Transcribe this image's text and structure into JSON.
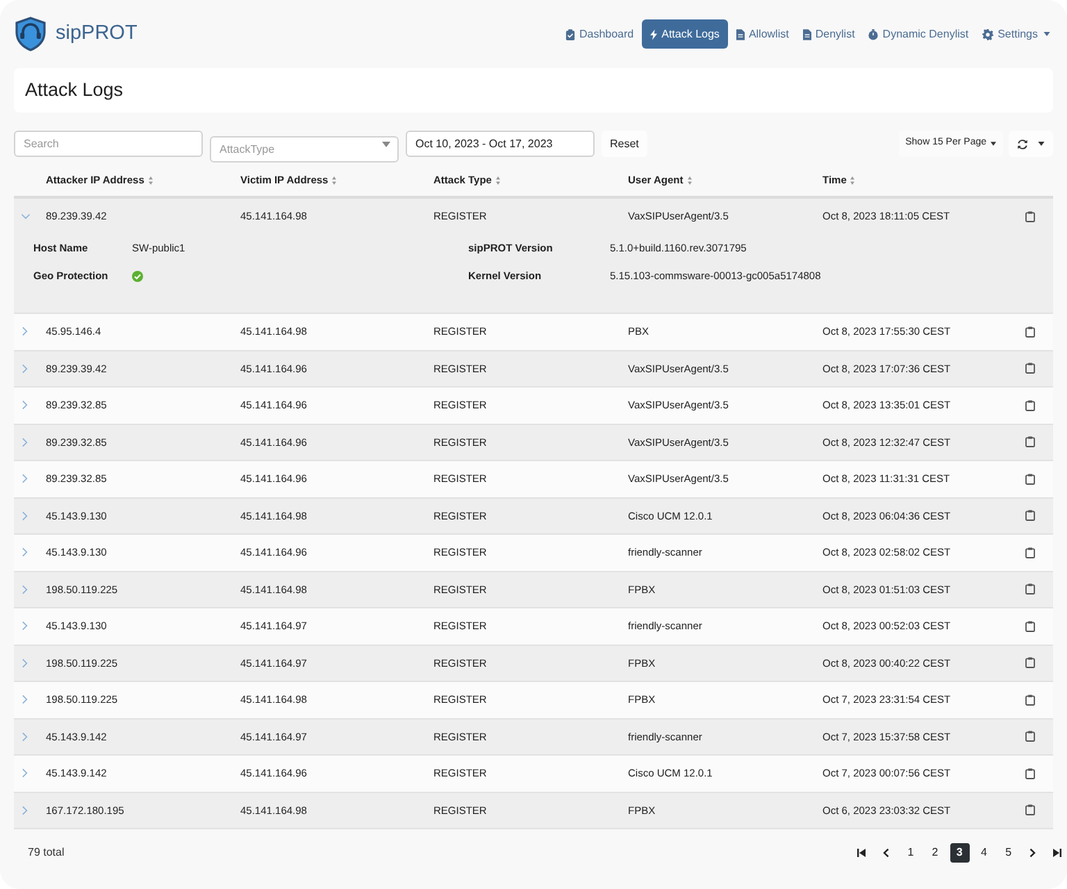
{
  "app": {
    "name": "sipPROT"
  },
  "nav": [
    {
      "label": "Dashboard",
      "selected": false,
      "dropdown": false
    },
    {
      "label": "Attack Logs",
      "selected": true,
      "dropdown": false
    },
    {
      "label": "Allowlist",
      "selected": false,
      "dropdown": false
    },
    {
      "label": "Denylist",
      "selected": false,
      "dropdown": false
    },
    {
      "label": "Dynamic Denylist",
      "selected": false,
      "dropdown": false
    },
    {
      "label": "Settings",
      "selected": false,
      "dropdown": true
    }
  ],
  "page": {
    "title": "Attack Logs"
  },
  "filters": {
    "search": {
      "placeholder": "Search"
    },
    "attack_type": {
      "placeholder": "AttackType"
    },
    "date_range": {
      "value": "Oct 10, 2023 - Oct 17, 2023"
    },
    "reset_button": "Reset",
    "per_page": "Show 15 Per Page"
  },
  "table": {
    "columns": [
      "Attacker IP Address",
      "Victim IP Address",
      "Attack Type",
      "User Agent",
      "Time"
    ],
    "rows": [
      {
        "expanded": true,
        "cells": [
          "89.239.39.42",
          "45.141.164.98",
          "REGISTER",
          "VaxSIPUserAgent/3.5",
          "Oct 8, 2023 18:11:05 CEST"
        ],
        "details": [
          {
            "kind": "text",
            "label": "Host Name",
            "value": "SW-public1"
          },
          {
            "kind": "text",
            "label": "sipPROT Version",
            "value": "5.1.0+build.1160.rev.3071795"
          },
          {
            "kind": "status",
            "label": "Geo Protection",
            "on": true
          },
          {
            "kind": "text",
            "label": "Kernel Version",
            "value": "5.15.103-commsware-00013-gc005a5174808"
          }
        ]
      },
      {
        "expanded": false,
        "cells": [
          "45.95.146.4",
          "45.141.164.98",
          "REGISTER",
          "PBX",
          "Oct 8, 2023 17:55:30 CEST"
        ]
      },
      {
        "expanded": false,
        "cells": [
          "89.239.39.42",
          "45.141.164.96",
          "REGISTER",
          "VaxSIPUserAgent/3.5",
          "Oct 8, 2023 17:07:36 CEST"
        ]
      },
      {
        "expanded": false,
        "cells": [
          "89.239.32.85",
          "45.141.164.96",
          "REGISTER",
          "VaxSIPUserAgent/3.5",
          "Oct 8, 2023 13:35:01 CEST"
        ]
      },
      {
        "expanded": false,
        "cells": [
          "89.239.32.85",
          "45.141.164.96",
          "REGISTER",
          "VaxSIPUserAgent/3.5",
          "Oct 8, 2023 12:32:47 CEST"
        ]
      },
      {
        "expanded": false,
        "cells": [
          "89.239.32.85",
          "45.141.164.96",
          "REGISTER",
          "VaxSIPUserAgent/3.5",
          "Oct 8, 2023 11:31:31 CEST"
        ]
      },
      {
        "expanded": false,
        "cells": [
          "45.143.9.130",
          "45.141.164.98",
          "REGISTER",
          "Cisco UCM 12.0.1",
          "Oct 8, 2023 06:04:36 CEST"
        ]
      },
      {
        "expanded": false,
        "cells": [
          "45.143.9.130",
          "45.141.164.96",
          "REGISTER",
          "friendly-scanner",
          "Oct 8, 2023 02:58:02 CEST"
        ]
      },
      {
        "expanded": false,
        "cells": [
          "198.50.119.225",
          "45.141.164.98",
          "REGISTER",
          "FPBX",
          "Oct 8, 2023 01:51:03 CEST"
        ]
      },
      {
        "expanded": false,
        "cells": [
          "45.143.9.130",
          "45.141.164.97",
          "REGISTER",
          "friendly-scanner",
          "Oct 8, 2023 00:52:03 CEST"
        ]
      },
      {
        "expanded": false,
        "cells": [
          "198.50.119.225",
          "45.141.164.97",
          "REGISTER",
          "FPBX",
          "Oct 8, 2023 00:40:22 CEST"
        ]
      },
      {
        "expanded": false,
        "cells": [
          "198.50.119.225",
          "45.141.164.98",
          "REGISTER",
          "FPBX",
          "Oct 7, 2023 23:31:54 CEST"
        ]
      },
      {
        "expanded": false,
        "cells": [
          "45.143.9.142",
          "45.141.164.97",
          "REGISTER",
          "friendly-scanner",
          "Oct 7, 2023 15:37:58 CEST"
        ]
      },
      {
        "expanded": false,
        "cells": [
          "45.143.9.142",
          "45.141.164.96",
          "REGISTER",
          "Cisco UCM 12.0.1",
          "Oct 7, 2023 00:07:56 CEST"
        ]
      },
      {
        "expanded": false,
        "cells": [
          "167.172.180.195",
          "45.141.164.98",
          "REGISTER",
          "FPBX",
          "Oct 6, 2023 23:03:32 CEST"
        ]
      }
    ]
  },
  "pagination": {
    "total": "79 total",
    "pages": [
      {
        "label": "1",
        "selected": false
      },
      {
        "label": "2",
        "selected": false
      },
      {
        "label": "3",
        "selected": true
      },
      {
        "label": "4",
        "selected": false
      },
      {
        "label": "5",
        "selected": false
      }
    ]
  }
}
